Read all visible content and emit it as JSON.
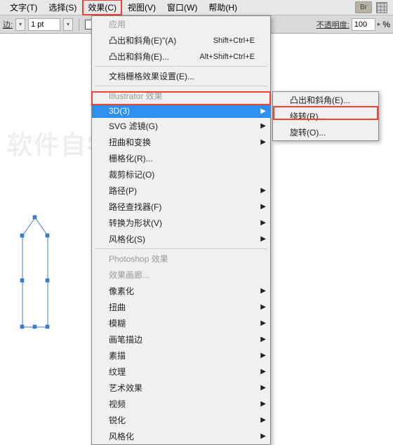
{
  "menubar": {
    "items": [
      "文字(T)",
      "选择(S)",
      "效果(C)",
      "视图(V)",
      "窗口(W)",
      "帮助(H)"
    ],
    "br": "Br"
  },
  "toolbar": {
    "stroke_label": "边:",
    "stroke_value": "1 pt",
    "opacity_label": "不透明度:",
    "opacity_value": "100",
    "opacity_unit": "%"
  },
  "menu": {
    "top": [
      {
        "label": "应用",
        "disabled": true
      },
      {
        "label": "凸出和斜角(E)\"(A)",
        "shortcut": "Shift+Ctrl+E"
      },
      {
        "label": "凸出和斜角(E)...",
        "shortcut": "Alt+Shift+Ctrl+E"
      }
    ],
    "doc_raster": "文档栅格效果设置(E)...",
    "ill_header": "Illustrator  效果",
    "ill": [
      {
        "label": "3D(3)",
        "sel": true,
        "arrow": true
      },
      {
        "label": "SVG 滤镜(G)",
        "arrow": true
      },
      {
        "label": "扭曲和变换",
        "arrow": true
      },
      {
        "label": "栅格化(R)..."
      },
      {
        "label": "裁剪标记(O)"
      },
      {
        "label": "路径(P)",
        "arrow": true
      },
      {
        "label": "路径查找器(F)",
        "arrow": true
      },
      {
        "label": "转换为形状(V)",
        "arrow": true
      },
      {
        "label": "风格化(S)",
        "arrow": true
      }
    ],
    "ps_header": "Photoshop  效果",
    "ps": [
      {
        "label": "效果画廊...",
        "disabled": true
      },
      {
        "label": "像素化",
        "arrow": true
      },
      {
        "label": "扭曲",
        "arrow": true
      },
      {
        "label": "模糊",
        "arrow": true
      },
      {
        "label": "画笔描边",
        "arrow": true
      },
      {
        "label": "素描",
        "arrow": true
      },
      {
        "label": "纹理",
        "arrow": true
      },
      {
        "label": "艺术效果",
        "arrow": true
      },
      {
        "label": "视频",
        "arrow": true
      },
      {
        "label": "锐化",
        "arrow": true
      },
      {
        "label": "风格化",
        "arrow": true
      }
    ]
  },
  "submenu": {
    "items": [
      {
        "label": "凸出和斜角(E)..."
      },
      {
        "label": "绕转(R)...",
        "red": true
      },
      {
        "label": "旋转(O)..."
      }
    ]
  },
  "watermark": "软件自学网"
}
